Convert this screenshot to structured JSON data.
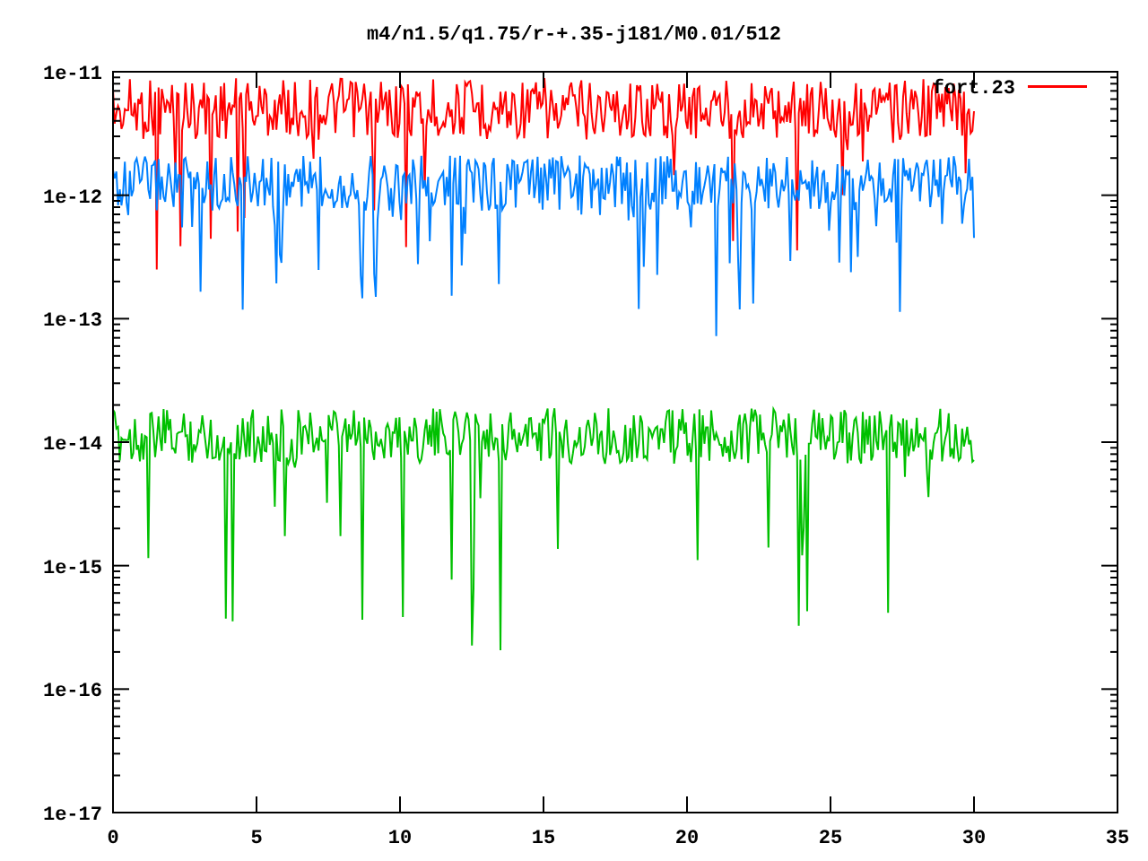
{
  "plot": {
    "title": "m4/n1.5/q1.75/r-+.35-j181/M0.01/512",
    "y_tick_labels": [
      "1e-11",
      "1e-12",
      "1e-13",
      "1e-14",
      "1e-15",
      "1e-16",
      "1e-17"
    ],
    "x_tick_labels": [
      "0",
      "5",
      "10",
      "15",
      "20",
      "25",
      "30",
      "35"
    ],
    "legend": [
      {
        "label": "fort.23",
        "color": "#ff0000"
      }
    ]
  }
}
